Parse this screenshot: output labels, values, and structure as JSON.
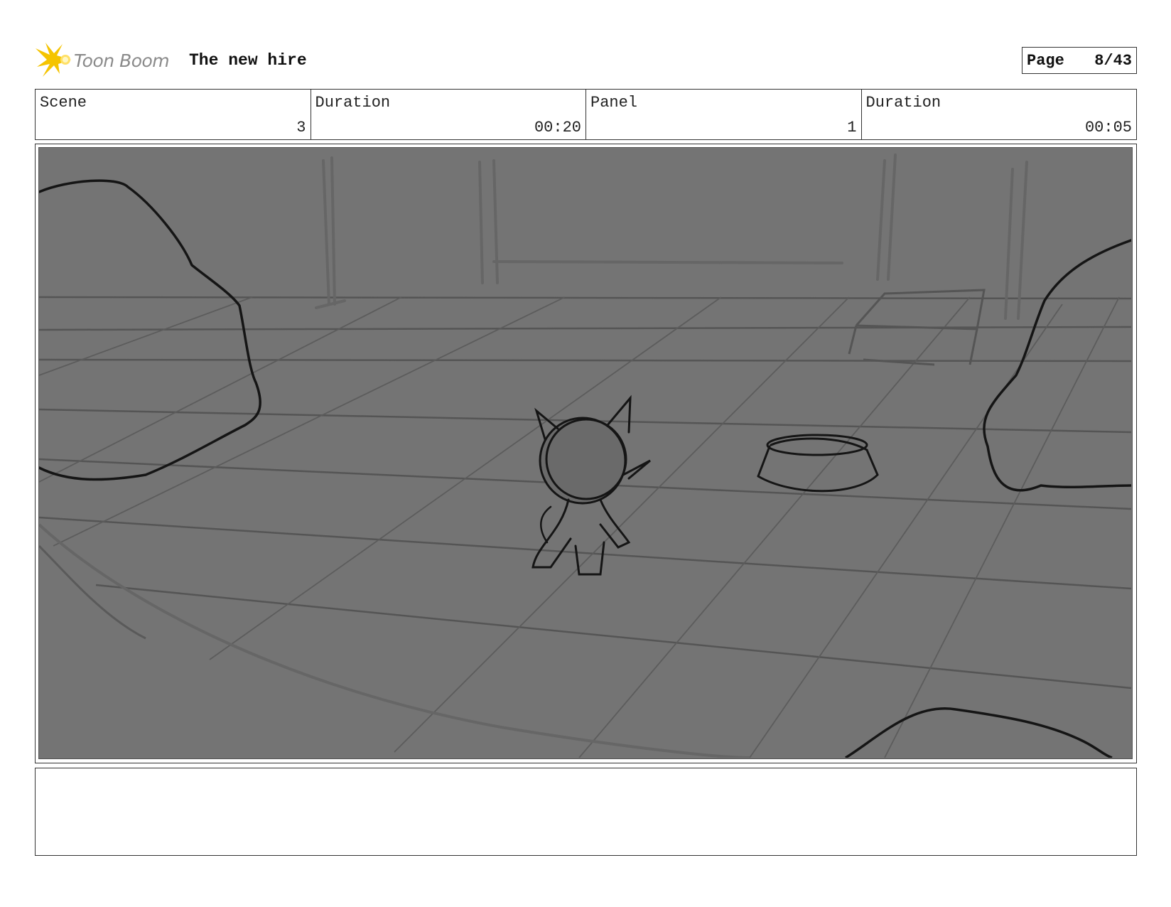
{
  "header": {
    "brand": "Toon Boom",
    "title": "The new hire",
    "page_label": "Page",
    "page_value": "8/43"
  },
  "info": {
    "scene_label": "Scene",
    "scene_value": "3",
    "scene_duration_label": "Duration",
    "scene_duration_value": "00:20",
    "panel_label": "Panel",
    "panel_value": "1",
    "panel_duration_label": "Duration",
    "panel_duration_value": "00:05"
  },
  "notes": {
    "text": ""
  },
  "colors": {
    "panel_bg": "#747474",
    "logo_yellow": "#f5c400",
    "sketch_dark": "#151515",
    "sketch_grid": "#555555"
  }
}
